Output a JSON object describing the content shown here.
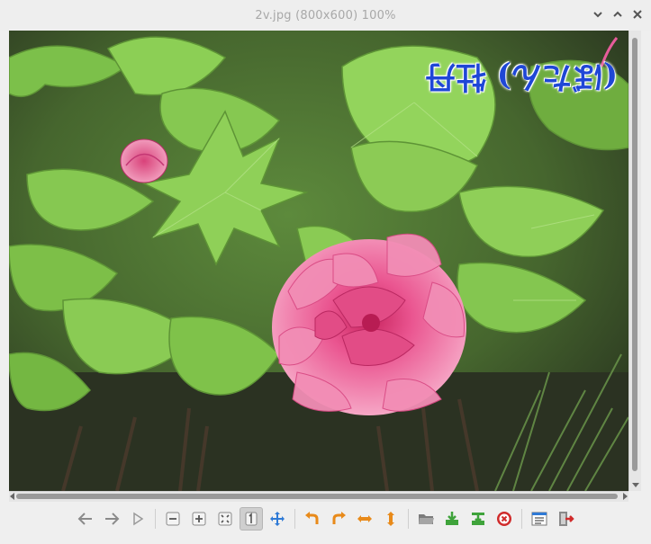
{
  "window": {
    "title": "2v.jpg (800x600) 100%"
  },
  "image": {
    "overlay_text": "(ぼたん) 牡丹",
    "description_colors": {
      "flower": "#e8457f",
      "leaf": "#7fc24a",
      "dark": "#2f3a22"
    }
  },
  "toolbar": {
    "buttons": [
      {
        "icon": "back-arrow-icon"
      },
      {
        "icon": "forward-arrow-icon"
      },
      {
        "icon": "play-icon"
      },
      {
        "icon": "zoom-out-icon"
      },
      {
        "icon": "zoom-in-icon"
      },
      {
        "icon": "fit-window-icon"
      },
      {
        "icon": "original-size-icon"
      },
      {
        "icon": "fullscreen-icon"
      },
      {
        "icon": "rotate-left-icon"
      },
      {
        "icon": "rotate-right-icon"
      },
      {
        "icon": "flip-horizontal-icon"
      },
      {
        "icon": "flip-vertical-icon"
      },
      {
        "icon": "open-folder-icon"
      },
      {
        "icon": "save-icon"
      },
      {
        "icon": "save-as-icon"
      },
      {
        "icon": "delete-icon"
      },
      {
        "icon": "preferences-icon"
      },
      {
        "icon": "quit-icon"
      }
    ]
  },
  "colors": {
    "title_text": "#a8a8a8",
    "accent_orange": "#e88a1a",
    "accent_green": "#3fa33b",
    "accent_red": "#d02b2b",
    "accent_blue": "#2f7ad6"
  }
}
